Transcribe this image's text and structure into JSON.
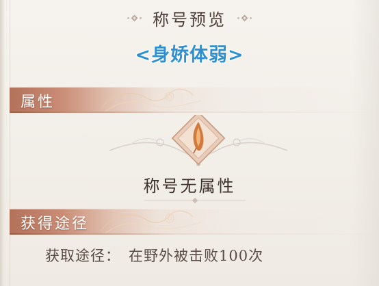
{
  "header": {
    "title": "称号预览"
  },
  "title_preview": {
    "name": "<身娇体弱>",
    "color": "#2f8fcf"
  },
  "attributes_section": {
    "label": "属性",
    "emblem_icon": "flame-feather-icon",
    "emblem_text": "称号无属性"
  },
  "acquire_section": {
    "label": "获得途径",
    "method_label": "获取途径：",
    "method_value": "在野外被击败100次"
  },
  "colors": {
    "section_header": "#b3715a",
    "emblem_diamond": "#e6cbb9",
    "flame": "#d07a3e",
    "text_dark": "#3e302b"
  }
}
